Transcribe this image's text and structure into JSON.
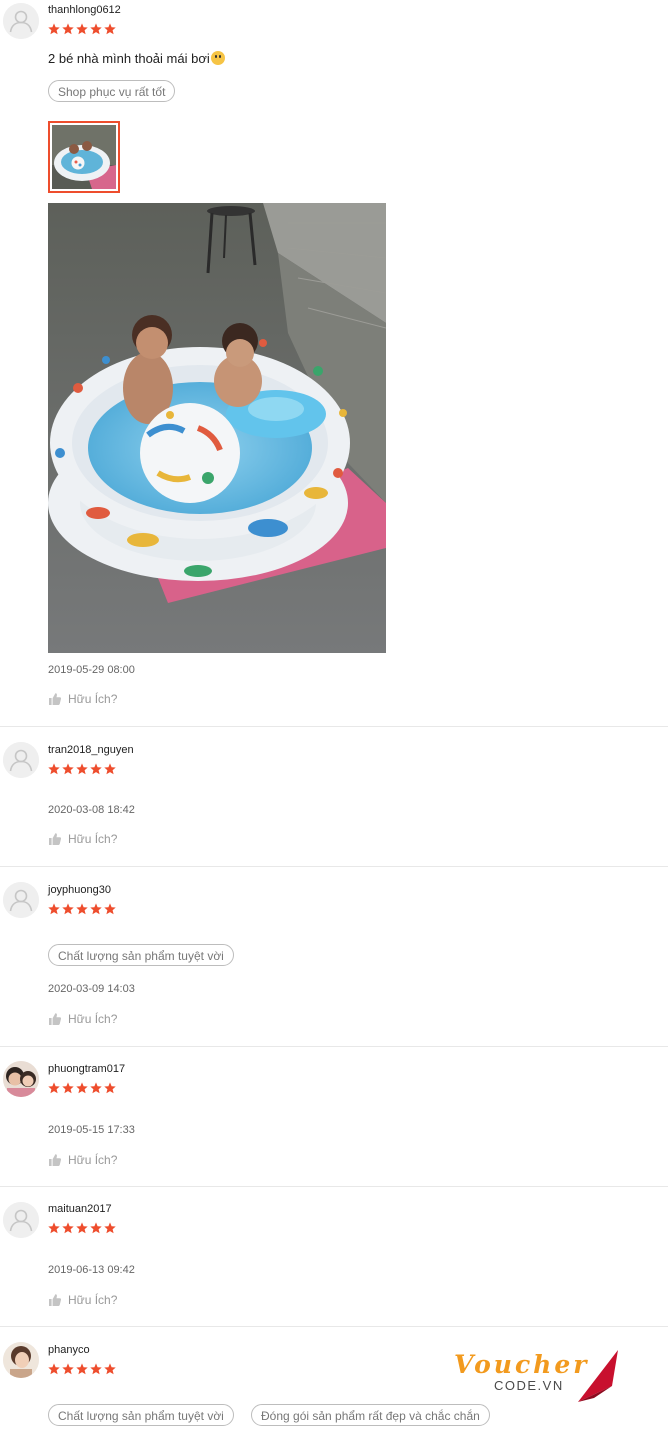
{
  "reviews": [
    {
      "username": "thanhlong0612",
      "rating": 5,
      "avatar": "default-avatar-icon",
      "text": "2 bé nhà mình thoải mái bơi",
      "emoji": "grinning-face-emoji",
      "tags": [
        "Shop phục vụ rất tốt"
      ],
      "date": "2019-05-29 08:00",
      "helpful_label": "Hữu Ích?"
    },
    {
      "username": "tran2018_nguyen",
      "rating": 5,
      "avatar": "default-avatar-icon",
      "date": "2020-03-08 18:42",
      "helpful_label": "Hữu Ích?"
    },
    {
      "username": "joyphuong30",
      "rating": 5,
      "avatar": "default-avatar-icon",
      "tags": [
        "Chất lượng sản phẩm tuyệt vời"
      ],
      "date": "2020-03-09 14:03",
      "helpful_label": "Hữu Ích?"
    },
    {
      "username": "phuongtram017",
      "rating": 5,
      "avatar": "photo-avatar",
      "date": "2019-05-15 17:33",
      "helpful_label": "Hữu Ích?"
    },
    {
      "username": "maituan2017",
      "rating": 5,
      "avatar": "default-avatar-icon",
      "date": "2019-06-13 09:42",
      "helpful_label": "Hữu Ích?"
    },
    {
      "username": "phanyco",
      "rating": 5,
      "avatar": "photo-avatar",
      "tags": [
        "Chất lượng sản phẩm tuyệt vời",
        "Đóng gói sản phẩm rất đẹp và chắc chắn"
      ]
    }
  ],
  "watermark": {
    "brand": "Voucher",
    "sub": "CODE.VN"
  },
  "colors": {
    "star": "#ee4d2d",
    "accent": "#ee4d2d",
    "divider": "#e8e8e8",
    "muted": "#999999"
  }
}
